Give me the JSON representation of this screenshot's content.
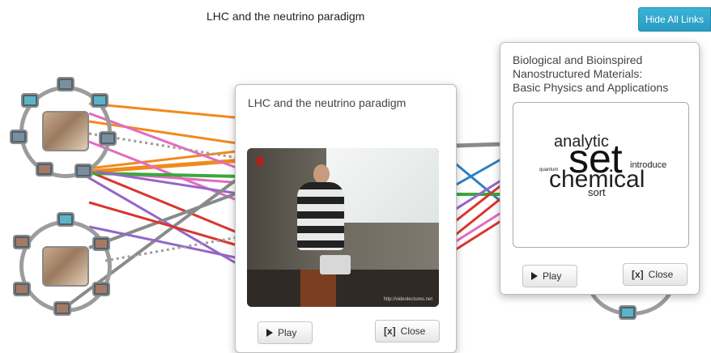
{
  "page": {
    "title": "LHC and the neutrino paradigm",
    "hide_links_label": "Hide All Links"
  },
  "colors": {
    "accent": "#2a9bc2",
    "link_orange": "#f08a1c",
    "link_pink": "#e36bc0",
    "link_purple": "#9466c8",
    "link_red": "#d9362e",
    "link_green": "#3aa83a",
    "link_gray": "#8a8a8a",
    "link_blue": "#2f7fc1"
  },
  "clusters": [
    {
      "name": "cluster-top",
      "nodes": 7
    },
    {
      "name": "cluster-bottom",
      "nodes": 7
    },
    {
      "name": "cluster-right",
      "nodes": 1
    }
  ],
  "modal_video": {
    "title": "LHC and the neutrino paradigm",
    "watermark": "http://videolectures.net",
    "play_label": "Play",
    "close_prefix": "[x]",
    "close_label": "Close"
  },
  "modal_cloud": {
    "title_lines": [
      "Biological and Bioinspired",
      "Nanostructured Materials:",
      "Basic Physics and Applications"
    ],
    "words": [
      "analytic",
      "set",
      "chemical",
      "introduce",
      "quantum",
      "sort"
    ],
    "play_label": "Play",
    "close_prefix": "[x]",
    "close_label": "Close"
  }
}
